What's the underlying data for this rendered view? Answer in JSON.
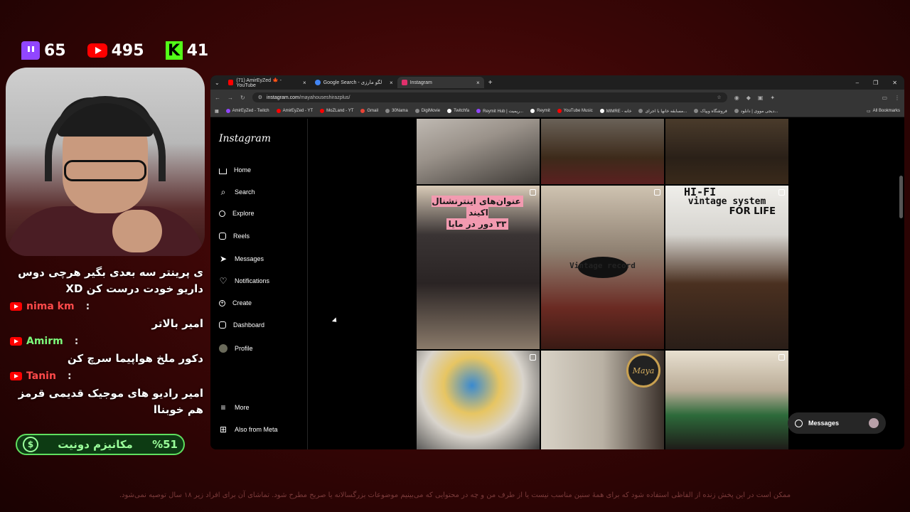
{
  "stats": {
    "twitch": "65",
    "youtube": "495",
    "kick": "41"
  },
  "chat": [
    {
      "type": "msg",
      "text": "ی پرینتر سه بعدی بگیر هرچی دوس داریو خودت درست کن XD"
    },
    {
      "type": "user",
      "name": "nima km",
      "color": "#ff4a4a"
    },
    {
      "type": "msg",
      "text": "امیر بالاتر"
    },
    {
      "type": "user",
      "name": "Amirm",
      "color": "#7dff7d"
    },
    {
      "type": "msg",
      "text": "دکور ملخ هواپیما سرچ کن"
    },
    {
      "type": "user",
      "name": "Tanin",
      "color": "#ff4a4a"
    },
    {
      "type": "msg",
      "text": "امیر رادیو های موجیک قدیمی قرمز هم خوبناا"
    }
  ],
  "donate": {
    "label": "مکانیزم دونیت",
    "percent": "%51"
  },
  "disclaimer": "ممکن است در این پخش زنده از الفاظی استفاده شود که برای همهٔ سنین مناسب نیست یا از طرف من و چه در محتوایی که می‌بینیم موضوعات بزرگسالانه یا صریح مطرح شود. تماشای آن برای افراد زیر ۱۸ سال توصیه نمی‌شود.",
  "browser": {
    "tabs": [
      {
        "title": "(71) AmirEyZed 🍁 - YouTube",
        "color": "#ff0000"
      },
      {
        "title": "Google Search - لگو مارزی",
        "color": "#4285f4"
      },
      {
        "title": "Instagram",
        "color": "#e1306c"
      }
    ],
    "url_host": "instagram.com",
    "url_path": "/mayahouseshirazplus/",
    "bookmarks": [
      "AmirEyZed - Twitch",
      "AmirEyZed - YT",
      "MoZLand - YT",
      "Gmail",
      "30Nama",
      "DigiMovie",
      "Twitchfa",
      "Reymit Hub | ریمیت...",
      "Reymit",
      "YouTube Music",
      "MIMRE - خانه",
      "مسابقه خانها با اجرای...",
      "فروشگاه ویپاک",
      "دیجی مووی | دانلود...",
      "All Bookmarks"
    ]
  },
  "instagram": {
    "logo": "Instagram",
    "nav": [
      {
        "id": "home",
        "label": "Home"
      },
      {
        "id": "search",
        "label": "Search"
      },
      {
        "id": "explore",
        "label": "Explore"
      },
      {
        "id": "reels",
        "label": "Reels"
      },
      {
        "id": "messages",
        "label": "Messages"
      },
      {
        "id": "notifications",
        "label": "Notifications"
      },
      {
        "id": "create",
        "label": "Create"
      },
      {
        "id": "dashboard",
        "label": "Dashboard"
      },
      {
        "id": "profile",
        "label": "Profile"
      }
    ],
    "more": "More",
    "meta": "Also from Meta",
    "post_overlay_fa": [
      "عنوان‌های اینترنشنال اکیند",
      "۳۳ دور در مایا"
    ],
    "post_overlay_en": [
      "HI-FI",
      "vintage system",
      "FOR LIFE"
    ],
    "post_overlay_en2": "Vintage record",
    "maya_badge": "Maya",
    "messages_bubble": "Messages"
  }
}
